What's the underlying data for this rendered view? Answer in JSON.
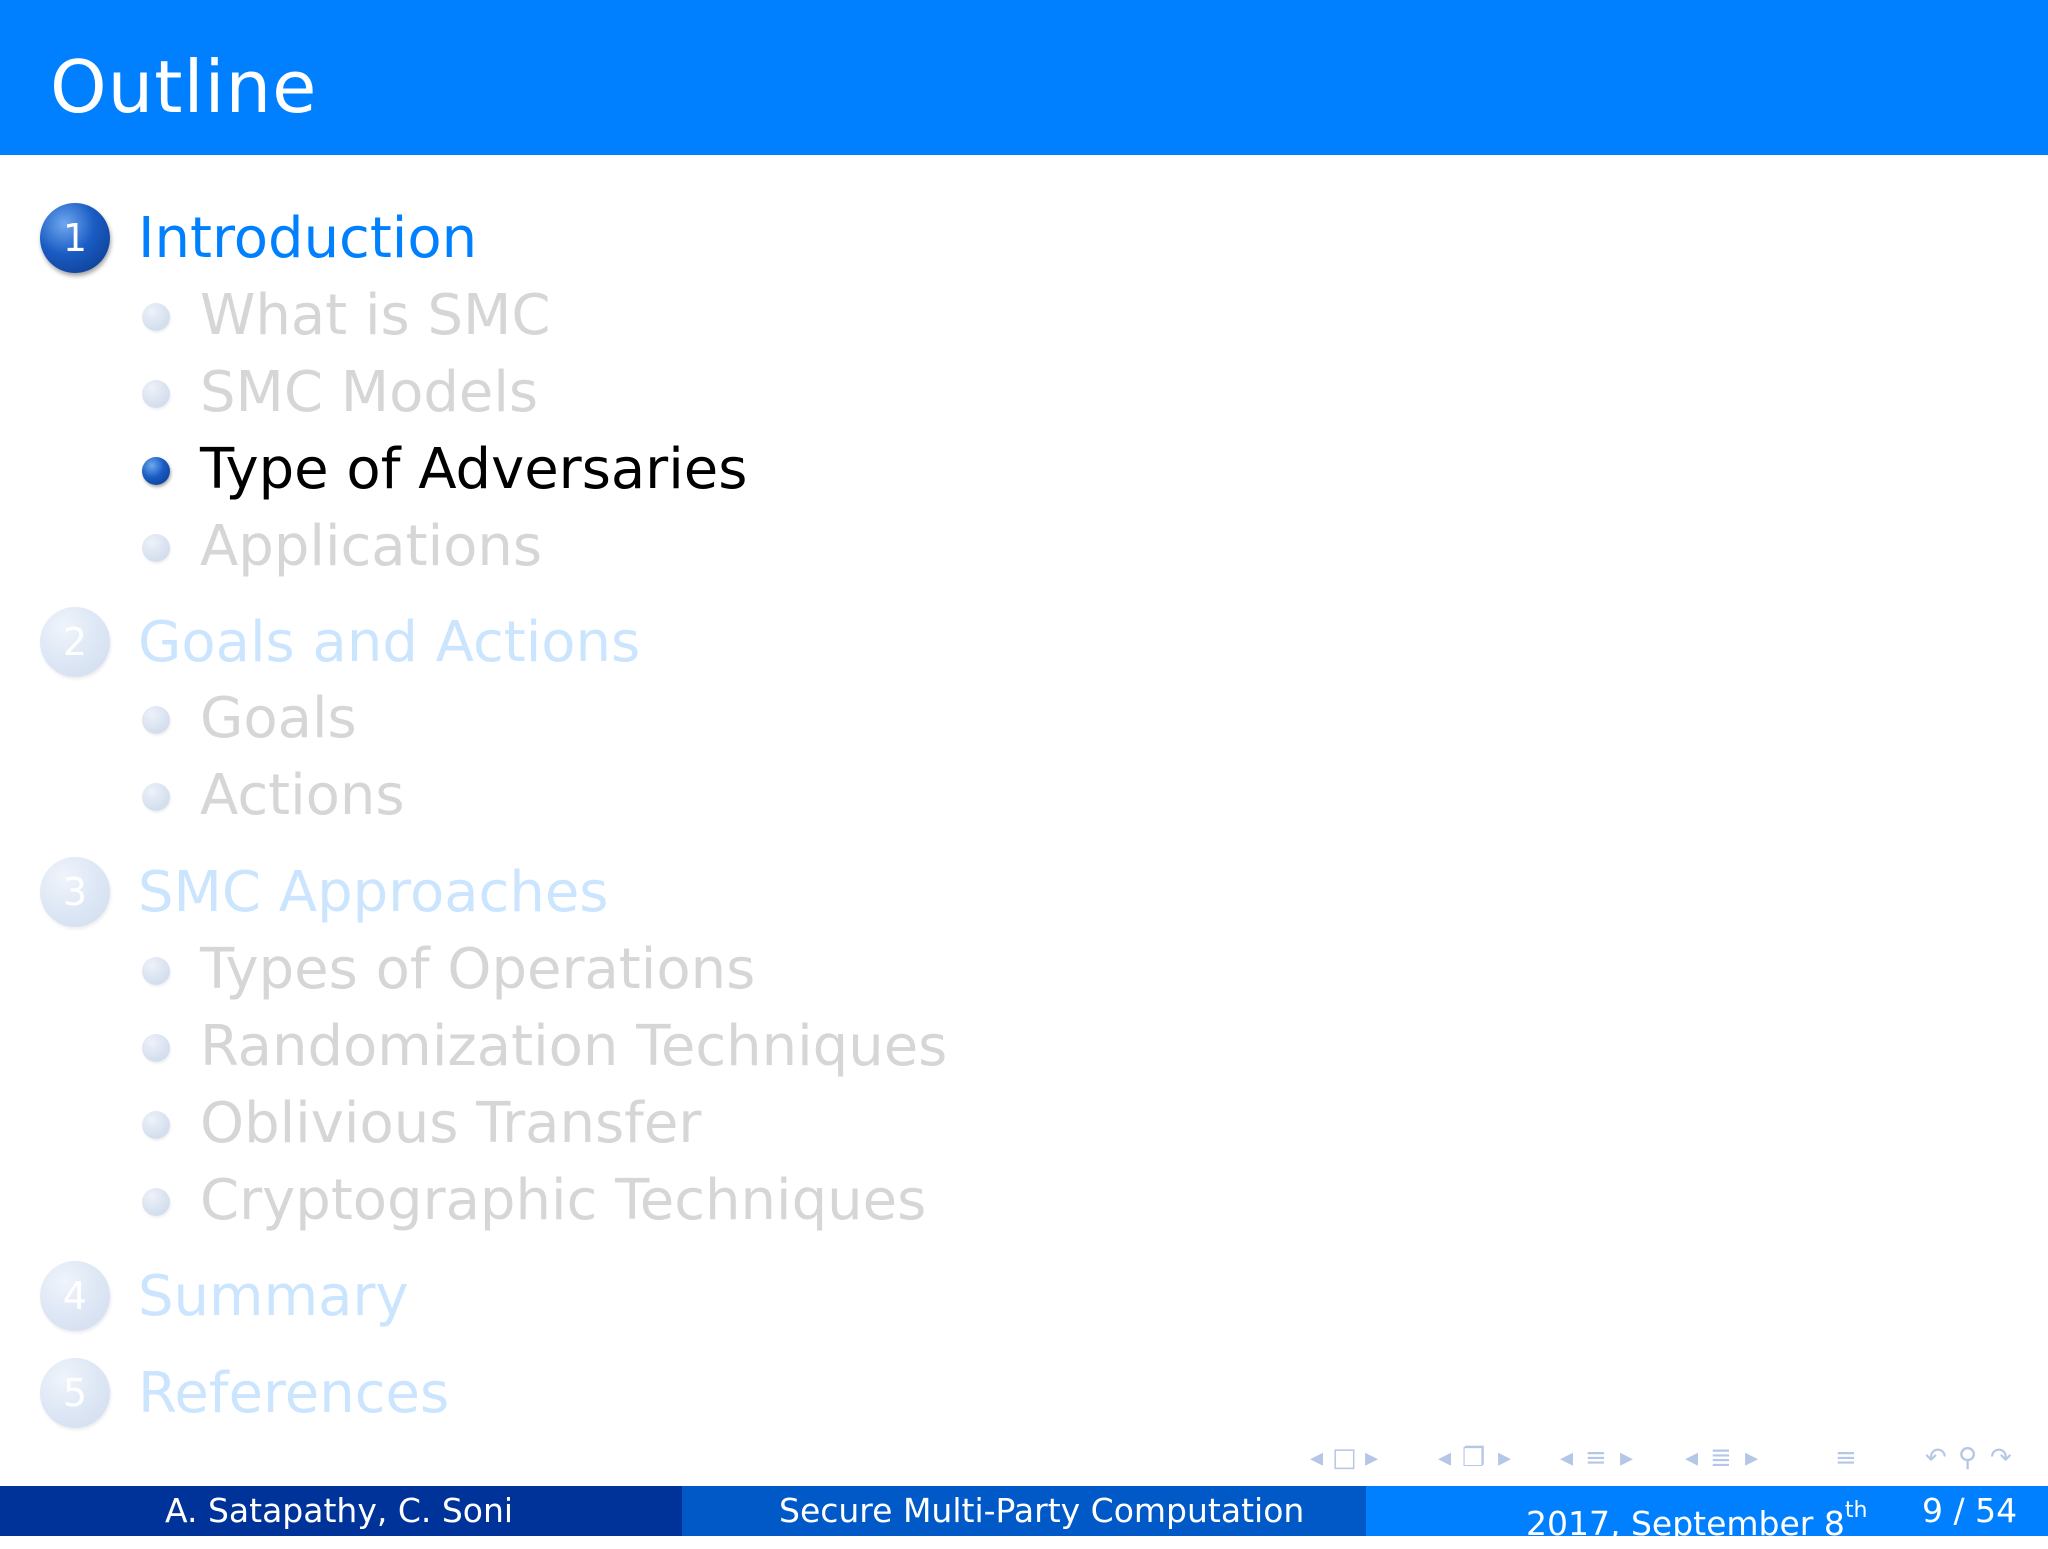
{
  "slide": {
    "title": "Outline"
  },
  "toc": {
    "sections": [
      {
        "number": "1",
        "label": "Introduction",
        "state": "active",
        "subsections": [
          {
            "label": "What is SMC",
            "state": "dim"
          },
          {
            "label": "SMC Models",
            "state": "dim"
          },
          {
            "label": "Type of Adversaries",
            "state": "active"
          },
          {
            "label": "Applications",
            "state": "dim"
          }
        ]
      },
      {
        "number": "2",
        "label": "Goals and Actions",
        "state": "dim",
        "subsections": [
          {
            "label": "Goals",
            "state": "dim"
          },
          {
            "label": "Actions",
            "state": "dim"
          }
        ]
      },
      {
        "number": "3",
        "label": "SMC Approaches",
        "state": "dim",
        "subsections": [
          {
            "label": "Types of Operations",
            "state": "dim"
          },
          {
            "label": "Randomization Techniques",
            "state": "dim"
          },
          {
            "label": "Oblivious Transfer",
            "state": "dim"
          },
          {
            "label": "Cryptographic Techniques",
            "state": "dim"
          }
        ]
      },
      {
        "number": "4",
        "label": "Summary",
        "state": "dim",
        "subsections": []
      },
      {
        "number": "5",
        "label": "References",
        "state": "dim",
        "subsections": []
      }
    ]
  },
  "footer": {
    "authors": "A.  Satapathy, C.  Soni",
    "presentation_title": "Secure Multi-Party Computation",
    "date": "2017, September 8",
    "date_sup": "th",
    "page": "9 / 54"
  },
  "nav_icons": [
    "prev-frame-icon",
    "frame-icon",
    "next-frame-icon",
    "prev-subsection-icon",
    "subsection-icon",
    "next-subsection-icon",
    "prev-section-icon",
    "section-icon",
    "next-section-icon",
    "prev-presentation-icon",
    "presentation-icon",
    "next-presentation-icon",
    "appendix-icon",
    "back-icon",
    "search-icon",
    "forward-icon"
  ],
  "colors": {
    "title_bar": "#0080ff",
    "active_section": "#0080ff",
    "dim_section": "#cce5ff",
    "dim_subsection": "#d6d6d6",
    "footer_left": "#00339a",
    "footer_mid": "#0059c6",
    "footer_right": "#0080ff"
  }
}
